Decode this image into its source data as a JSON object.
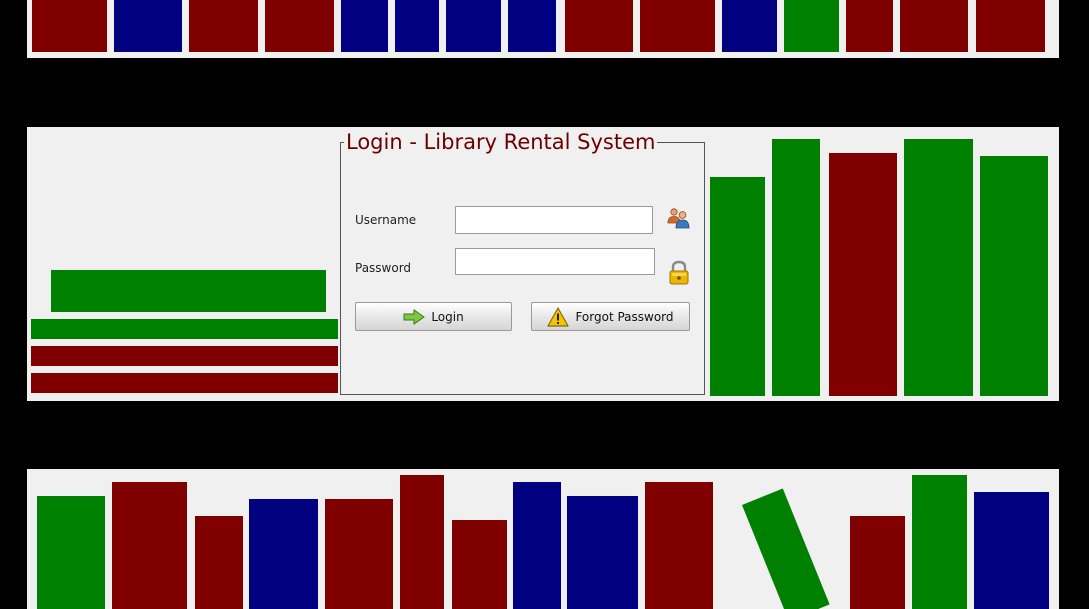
{
  "window": {
    "title": "Login - Library Rental System"
  },
  "form": {
    "username_label": "Username",
    "username_value": "",
    "password_label": "Password",
    "password_value": "",
    "login_button_label": "Login",
    "forgot_button_label": "Forgot Password"
  },
  "icons": {
    "users": "users-icon",
    "lock": "lock-icon",
    "login": "arrow-right-icon",
    "forgot": "warning-icon"
  },
  "colors": {
    "book_red": "#800000",
    "book_blue": "#000080",
    "book_green": "#008000",
    "title": "#6b0000",
    "shelf": "#f0f0f0",
    "background": "#000000"
  }
}
